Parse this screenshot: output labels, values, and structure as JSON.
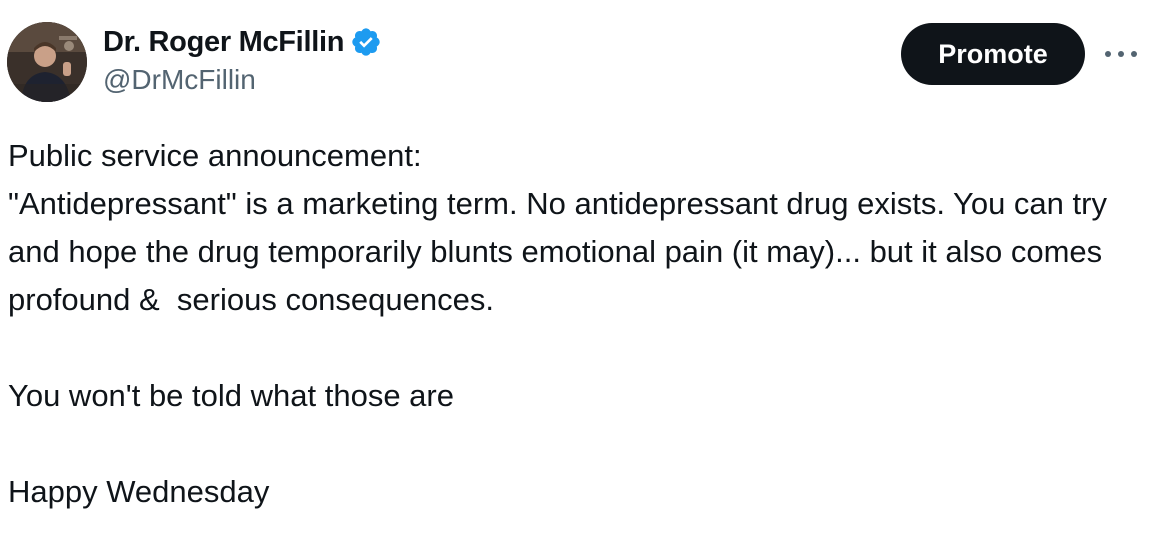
{
  "author": {
    "display_name": "Dr. Roger McFillin",
    "handle": "@DrMcFillin",
    "verified": true,
    "avatar_icon": "profile-photo",
    "verified_icon": "verified-badge-icon",
    "verified_color": "#1d9bf0"
  },
  "actions": {
    "promote_label": "Promote",
    "more_icon": "more-icon"
  },
  "tweet": {
    "paragraphs": [
      "Public service announcement:",
      "\"Antidepressant\" is a marketing term. No antidepressant drug exists. You can try and hope the drug temporarily blunts emotional pain (it may)... but it also comes profound &  serious consequences.",
      "",
      "You won't be told what those are",
      "",
      "Happy Wednesday"
    ]
  },
  "colors": {
    "text_primary": "#0f1419",
    "text_secondary": "#536471",
    "button_bg": "#0f1419",
    "button_text": "#ffffff"
  }
}
